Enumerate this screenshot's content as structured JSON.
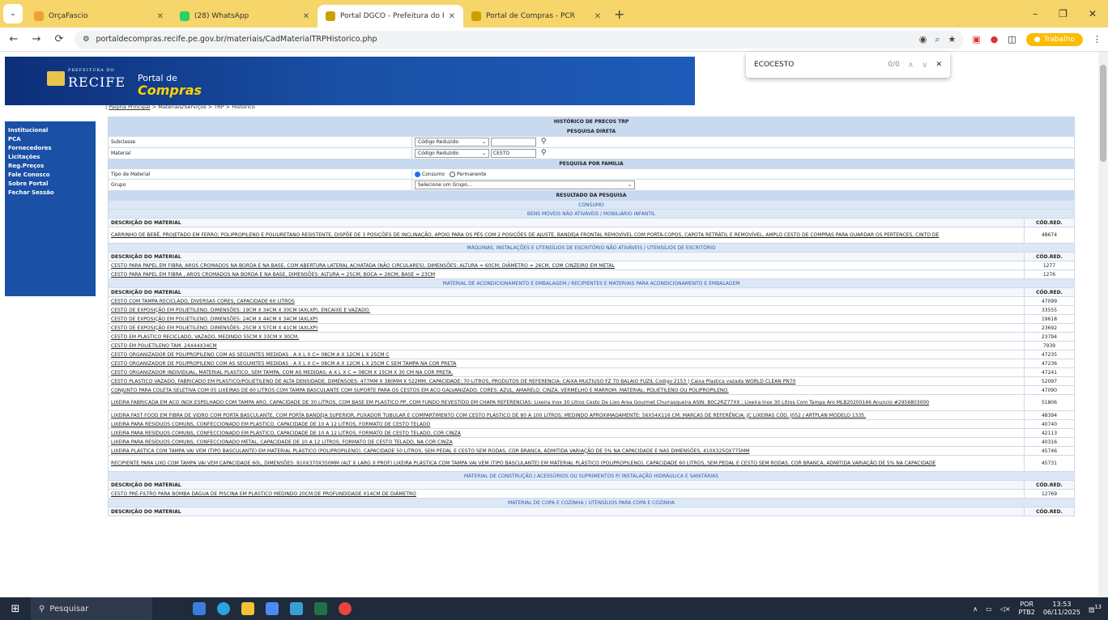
{
  "browser": {
    "tabs": [
      {
        "title": "OrçaFascio",
        "color": "#f0a030",
        "active": false
      },
      {
        "title": "(28) WhatsApp",
        "color": "#25d366",
        "active": false
      },
      {
        "title": "Portal DGCO - Prefeitura do Re",
        "color": "#c9a000",
        "active": true
      },
      {
        "title": "Portal de Compras - PCR",
        "color": "#c9a000",
        "active": false
      }
    ],
    "new_tab": "+",
    "url": "portaldecompras.recife.pe.gov.br/materiais/CadMaterialTRPHistorico.php",
    "profile": "Trabalho"
  },
  "findbar": {
    "query": "ECOCESTO",
    "count": "0/0"
  },
  "banner": {
    "pref": "PREFEITURA DO",
    "recife": "RECIFE",
    "portal": "Portal de",
    "compras": "Compras"
  },
  "sidebar": {
    "items": [
      "Institucional",
      "PCA",
      "Fornecedores",
      "Licitações",
      "Reg.Preços",
      "Fale Conosco",
      "Sobre Portal",
      "Fechar Sessão"
    ]
  },
  "breadcrumb": {
    "home": "Página Principal",
    "rest": " > Materiais/Serviços > TRP > Histórico"
  },
  "form": {
    "title": "HISTÓRICO DE PRECOS TRP",
    "direct": "PESQUISA DIRETA",
    "subclasse_label": "Subclasse",
    "subclasse_select": "Código Reduzido",
    "material_label": "Material",
    "material_select": "Código Reduzido",
    "material_value": "CESTO",
    "family": "PESQUISA POR FAMILIA",
    "tipo_label": "Tipo de Material",
    "radio_consumo": "Consumo",
    "radio_permanente": "Permanente",
    "grupo_label": "Grupo",
    "grupo_select": "Selecione um Grupo...",
    "result": "RESULTADO DA PESQUISA"
  },
  "results": {
    "consumo": "CONSUMO",
    "col_desc": "DESCRIÇÃO DO MATERIAL",
    "col_code": "CÓD.RED.",
    "groups": [
      {
        "name": "BENS MÓVEIS NÃO ATIVÁVEIS / MOBILIÁRIO INFANTIL",
        "items": [
          {
            "desc": "CARRINHO DE BEBÊ, PROJETADO EM FERRO; POLIPROPILENO E POLIURETANO RESISTENTE, DISPÕE DE 3 POSIÇÕES DE INCLINAÇÃO, APOIO PARA OS PÉS COM 2 POSIÇÕES DE AJUSTE, BANDEJA FRONTAL REMOVÍVEL COM PORTA-COPOS, CAPOTA RETRÁTIL E REMOVÍVEL, AMPLO CESTO DE COMPRAS PARA GUARDAR OS PERTENCES, CINTO DE",
            "code": "48674",
            "tall": true
          }
        ]
      },
      {
        "name": "MÁQUINAS, INSTALAÇÕES E UTENSÍLIOS DE ESCRITÓRIO NÃO ATIVÁVEIS / UTENSÍLIOS DE ESCRITÓRIO",
        "items": [
          {
            "desc": "CESTO PARA PAPEL EM FIBRA, AROS CROMADOS NA BORDA E NA BASE, COM ABERTURA LATERAL ACHATADA (NÃO CIRCULARES), DIMENSÕES: ALTURA = 60CM; DIÂMETRO = 26CM, COM CINZEIRO EM METAL",
            "code": "1277"
          },
          {
            "desc": "CESTO PARA PAPEL EM FIBRA , AROS CROMADOS NA BORDA E NA BASE, DIMENSÕES: ALTURA = 25CM; BOCA = 26CM; BASE = 23CM",
            "code": "1276"
          }
        ]
      },
      {
        "name": "MATERIAL DE ACONDICIONAMENTO E EMBALAGEM / RECIPIENTES E MATERIAIS PARA ACONDICIONAMENTO E EMBALAGEM",
        "items": [
          {
            "desc": "CESTO COM TAMPA RECICLADO, DIVERSAS CORES, CAPACIDADE 60 LITROS",
            "code": "47099"
          },
          {
            "desc": "CESTO DE EXPOSIÇÃO EM POLIETILENO, DIMENSÕES: 19CM X 34CM X 30CM (AXLXP), ENCAIXE E VAZADO.",
            "code": "33555"
          },
          {
            "desc": "CESTO DE EXPOSIÇÃO EM POLIETILENO, DIMENSÕES: 24CM X 44CM X 34CM (AXLXP)",
            "code": "19618"
          },
          {
            "desc": "CESTO DE EXPOSIÇÃO EM POLIETILENO, DIMENSÕES: 25CM X 57CM X 41CM (AXLXP)",
            "code": "23692"
          },
          {
            "desc": "CESTO EM PLÁSTICO RECICLADO, VAZADO, MEDINDO 55CM X 33CM X 30CM.",
            "code": "23794"
          },
          {
            "desc": "CESTO EM POLIETILENO TAM. 24X44X34CM",
            "code": "7939"
          },
          {
            "desc": "CESTO ORGANIZADOR DE POLIPROPILENO COM AS SEGUINTES MEDIDAS : A X L X C= 08CM A X 12CM L X 25CM C",
            "code": "47235"
          },
          {
            "desc": "CESTO ORGANIZADOR DE POLIPROPILENO COM AS SEGUINTES MEDIDAS : A X L X C= 08CM A X 12CM L X 25CM C SEM TAMPA NA COR PRETA",
            "code": "47236"
          },
          {
            "desc": "CESTO ORGANIZADOR INDIVIDUAL, MATERIAL PLASTICO, SEM TAMPA, COM AS MEDIDAS: A X L X C = 08CM X 15CM X 30 CM NA COR PRETA.",
            "code": "47241"
          },
          {
            "desc": "CESTO PLASTICO VAZADO, FABRICADO EM PLASTICO/POLIETILENO DE ALTA DENSIDADE, DIMENSOES: 477MM X 380MM X 522MM, CAPACIDADE: 70 LITROS, PRODUTOS DE REFERENCIA: CAIXA MULTIUSO FZ 70 BALAIO FUZIL Codigo 2153 | Caixa Plastica vazada WORLD CLEAN PN70",
            "code": "52097"
          },
          {
            "desc": "CONJUNTO PARA COLETA SELETIVA COM 05 LIXEIRAS DE 60 LITROS COM TAMPA BASCULANTE COM SUPORTE PARA OS CESTOS EM ACO GALVANIZADO. CORES: AZUL, AMARELO, CINZA, VERMELHO E MARROM. MATERIAL: POLIETILENO OU POLIPROPILENO.",
            "code": "47090"
          },
          {
            "desc": "LIXEIRA FABRICADA EM ACO INOX ESPELHADO COM TAMPA ARO, CAPACIDADE DE 30 LITROS, COM BASE EM PLASTICO PP, COM FUNDO REVESTIDO EM CHAPA REFERENCIAS: Lixeira Inox 30 Litros Cesto De Lixo Area Gourmet Churrasqueira ASIN: B0C2RZ77XX ; Lixeira Inox 30 Litros Com Tampa Aro MLB20200146 Anuncio #2956803000",
            "code": "51806",
            "tall": true
          },
          {
            "desc": "LIXEIRA FAST FOOD EM FIBRA DE VIDRO COM PORTA BASCULANTE, COM PORTA BANDEJA SUPERIOR, PUXADOR TUBULAR E COMPARTIMENTO COM CESTO PLÁSTICO DE 80 À 100 LITROS; MEDINDO APROXIMADAMENTE: 56X54X116 CM; MARCAS DE REFERÊNCIA: JC LIXEIRAS CÓD. J052 / ARTPLAN MODELO 1335.",
            "code": "48394"
          },
          {
            "desc": "LIXEIRA PARA RESIDUOS COMUNS, CONFECCIONADO EM PLASTICO, CAPACIDADE DE 10 A 12 LITROS, FORMATO DE CESTO TELADO",
            "code": "40740"
          },
          {
            "desc": "LIXEIRA PARA RESÍDUOS COMUNS, CONFECCIONADO EM PLÁSTICO, CAPACIDADE DE 10 A 12 LITROS, FORMATO DE CESTO TELADO, COR CINZA",
            "code": "42113"
          },
          {
            "desc": "LIXEIRA PARA RESÍDUOS COMUNS, CONFECCIONADO METAL, CAPACIDADE DE 10 A 12 LITROS, FORMATO DE CESTO TELADO, NA COR CINZA",
            "code": "40316"
          },
          {
            "desc": "LIXEIRA PLÁSTICA COM TAMPA VAI VEM (TIPO BASCULANTE) EM MATERIAL PLÁSTICO (POLIPROPILENO), CAPACIDADE 50 LITROS, SEM PEDAL E CESTO SEM RODAS, COR BRANCA, ADMITIDA VARIAÇÃO DE 5% NA CAPACIDADE E NAS DIMENSÕES, 410X325OX775MM",
            "code": "45746"
          },
          {
            "desc": "RECIPIENTE PARA LIXO COM TAMPA VAI VEM CAPACIDADE 60L, DIMENSÕES: 910X370X350MM (ALT X LARG X PROF) LIXEIRA PLÁSTICA COM TAMPA VAI VEM (TIPO BASCULANTE) EM MATERIAL PLÁSTICO (POLIPROPILENO), CAPACIDADE 60 LITROS, SEM PEDAL E CESTO SEM RODAS, COR BRANCA, ADMITIDA VARIAÇÃO DE 5% NA CAPACIDADE",
            "code": "45731",
            "tall": true
          }
        ]
      },
      {
        "name": "MATERIAL DE CONSTRUÇÃO / ACESSÓRIOS OU SUPRIMENTOS P/ INSTALAÇÃO HIDRÁULICA E SANITÁRIAS",
        "items": [
          {
            "desc": "CESTO PRÉ-FILTRO PARA BOMBA DÁGUA DE PISCINA EM PLÁSTICO MEDINDO 20CM DE PROFUNDIDADE X14CM DE DIÂMETRO",
            "code": "12769"
          }
        ]
      },
      {
        "name": "MATERIAL DE COPA E COZINHA / UTENSÍLIOS PARA COPA E COZINHA",
        "items": []
      }
    ]
  },
  "taskbar": {
    "search": "Pesquisar",
    "lang": "POR",
    "layout": "PTB2",
    "time": "13:53",
    "date": "06/11/2025",
    "notif": "13"
  }
}
